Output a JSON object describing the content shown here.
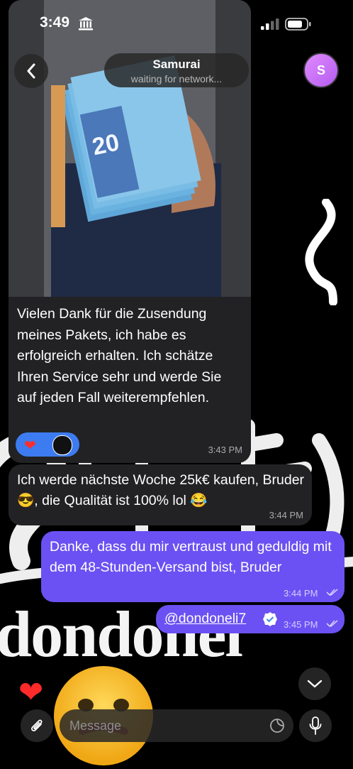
{
  "status_bar": {
    "time": "3:49"
  },
  "header": {
    "contact_name": "Samurai",
    "contact_status": "waiting for network...",
    "avatar_letter": "S"
  },
  "messages": [
    {
      "direction": "incoming",
      "has_photo": true,
      "photo_banknote_value": "20",
      "text": "Vielen Dank für die Zusendung meines Pakets, ich habe es erfolgreich erhalten. Ich schätze Ihren Service sehr und werde Sie auf jeden Fall weiterempfehlen.",
      "reactions": [
        "heart"
      ],
      "time": "3:43 PM"
    },
    {
      "direction": "incoming",
      "text": "Ich werde nächste Woche 25k€ kaufen, Bruder 😎, die Qualität ist 100% lol 😂",
      "time": "3:44 PM"
    },
    {
      "direction": "outgoing",
      "text": "Danke, dass du mir vertraust und geduldig mit dem 48-Stunden-Versand bist, Bruder",
      "time": "3:44 PM",
      "read": true
    },
    {
      "direction": "outgoing",
      "text": "@dondoneli7",
      "verified": true,
      "time": "3:45 PM",
      "read": true
    }
  ],
  "background": {
    "text": "dondonel"
  },
  "composer": {
    "placeholder": "Message"
  },
  "colors": {
    "incoming_bubble": "#222224",
    "outgoing_bubble": "#6b51f3",
    "reaction_pill": "#3d7cf0",
    "avatar": "#c26ef5"
  }
}
